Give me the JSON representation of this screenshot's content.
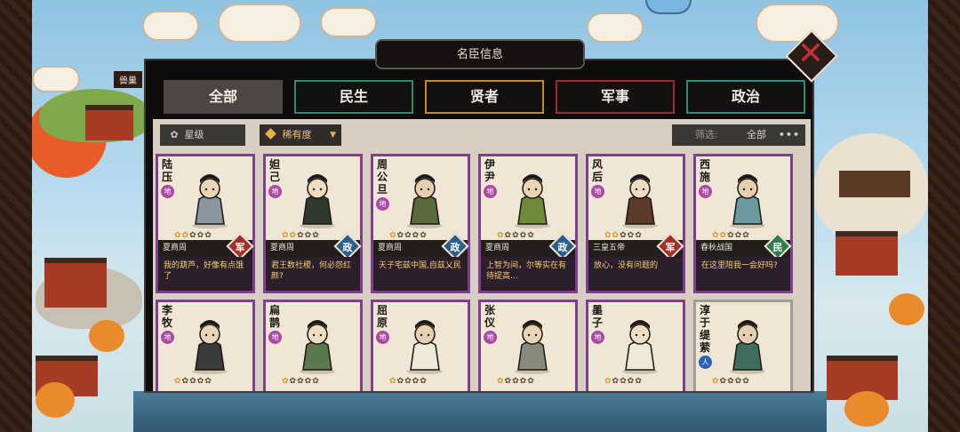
{
  "scene": {
    "left_sign": "兽巢"
  },
  "dialog": {
    "title": "名臣信息",
    "close_icon": "close-x-icon"
  },
  "tabs": [
    {
      "label": "全部",
      "active": true
    },
    {
      "label": "民生",
      "active": false
    },
    {
      "label": "贤者",
      "active": false
    },
    {
      "label": "军事",
      "active": false
    },
    {
      "label": "政治",
      "active": false
    }
  ],
  "filters": {
    "star_label": "星级",
    "rarity_label": "稀有度",
    "filter_label": "筛选:",
    "filter_value": "全部",
    "more_icon": "ellipsis-icon"
  },
  "colors": {
    "军": "#a33029",
    "政": "#2c5e8b",
    "民": "#2f7d4b",
    "card_border": "#7e3f8f"
  },
  "cards": [
    {
      "name": "陆压",
      "badge": "地",
      "stars": 2,
      "era": "夏商周",
      "category": "军",
      "quote": "我的葫芦，好像有点饿了"
    },
    {
      "name": "妲己",
      "badge": "地",
      "stars": 2,
      "era": "夏商周",
      "category": "政",
      "quote": "君王数社稷，何必怨红颜?"
    },
    {
      "name": "周公旦",
      "badge": "地",
      "stars": 1,
      "era": "夏商周",
      "category": "政",
      "quote": "天子宅兹中国,自兹乂民"
    },
    {
      "name": "伊尹",
      "badge": "地",
      "stars": 1,
      "era": "夏商周",
      "category": "政",
      "quote": "上智为间，尔等实在有待提高…"
    },
    {
      "name": "风后",
      "badge": "地",
      "stars": 2,
      "era": "三皇五帝",
      "category": "军",
      "quote": "放心，没有问题的"
    },
    {
      "name": "西施",
      "badge": "地",
      "stars": 2,
      "era": "春秋战国",
      "category": "民",
      "quote": "在这里陪我一会好吗?"
    },
    {
      "name": "李牧",
      "badge": "地",
      "stars": 1
    },
    {
      "name": "扁鹊",
      "badge": "地",
      "stars": 1
    },
    {
      "name": "屈原",
      "badge": "地",
      "stars": 1
    },
    {
      "name": "张仪",
      "badge": "地",
      "stars": 1
    },
    {
      "name": "墨子",
      "badge": "地",
      "stars": 1
    },
    {
      "name": "淳于缇萦",
      "badge": "人",
      "stars": 1
    }
  ]
}
